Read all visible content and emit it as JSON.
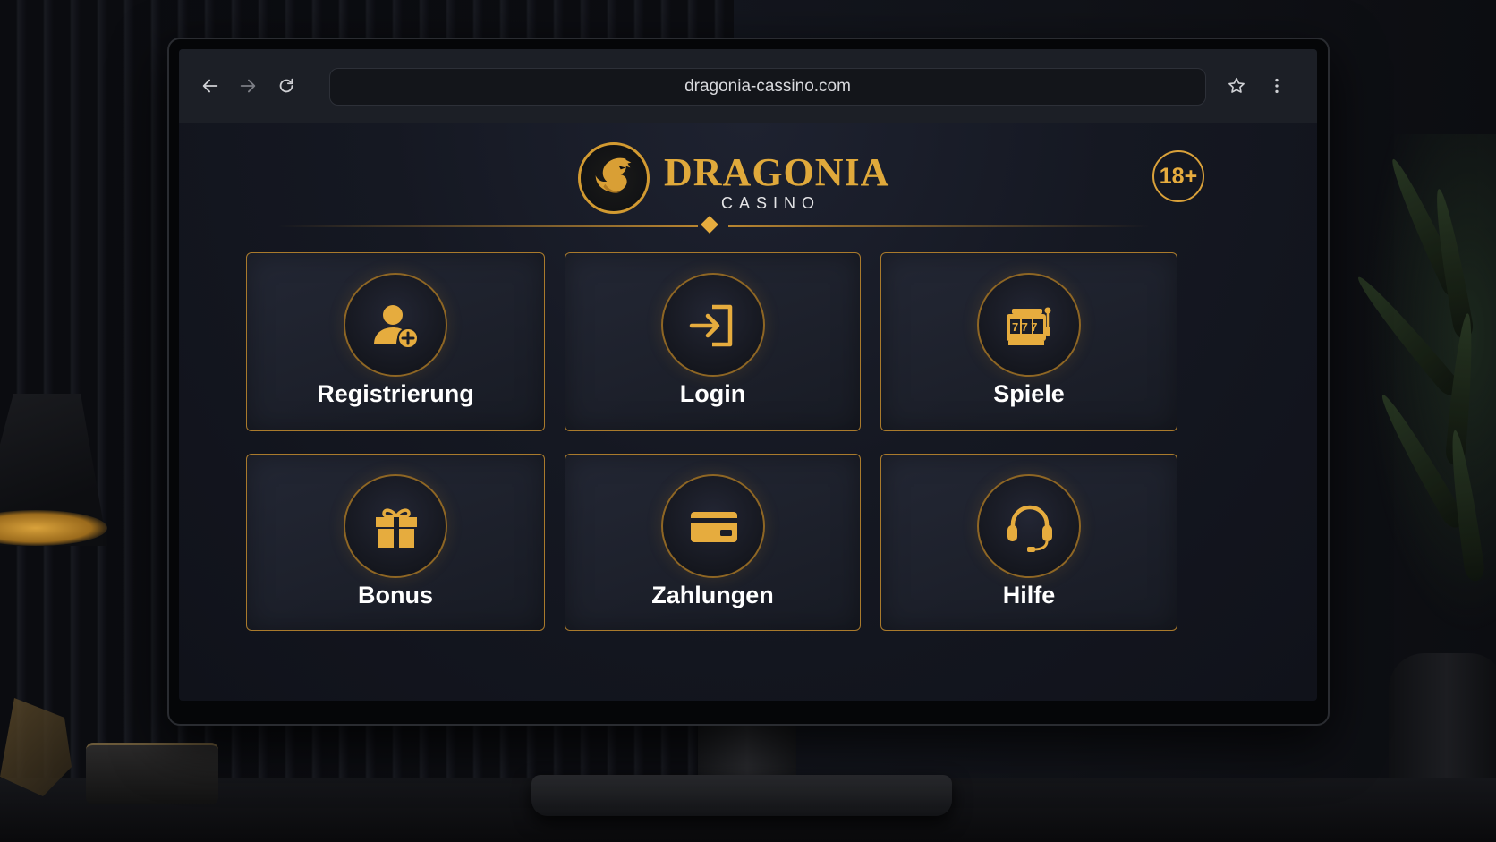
{
  "browser": {
    "url": "dragonia-cassino.com",
    "icons": [
      "back-arrow-icon",
      "forward-arrow-icon",
      "reload-icon",
      "star-icon",
      "more-vert-icon"
    ]
  },
  "header": {
    "brand": "DRAGONIA",
    "subtitle": "CASINO",
    "age_badge": "18+",
    "logo_icon": "dragon-icon"
  },
  "colors": {
    "accent": "#e0a93b",
    "background": "#151822",
    "tile": "#1e2230",
    "text": "#ffffff"
  },
  "tiles": [
    {
      "label": "Registrierung",
      "icon": "add-user-icon"
    },
    {
      "label": "Login",
      "icon": "login-icon"
    },
    {
      "label": "Spiele",
      "icon": "slot-machine-icon"
    },
    {
      "label": "Bonus",
      "icon": "gift-icon"
    },
    {
      "label": "Zahlungen",
      "icon": "credit-card-icon"
    },
    {
      "label": "Hilfe",
      "icon": "headset-icon"
    }
  ],
  "slot_icon_text": "777"
}
